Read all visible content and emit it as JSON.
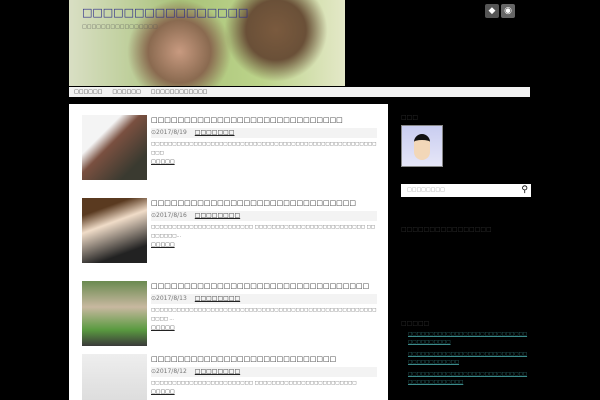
{
  "site": {
    "title": "□□□□□□□□□□□□□□□□",
    "description": "□□□□□□□□□□□□□□□□"
  },
  "header_icons": [
    "feedly-icon",
    "rss-icon"
  ],
  "nav": [
    "□□□□□□",
    "□□□□□□",
    "□□□□□□□□□□□□"
  ],
  "posts": [
    {
      "title": "□□□□□□□□□□□□□□□□□□□□□□□□□□□□□",
      "date": "2017/8/19",
      "category": "□□□□□□□",
      "excerpt": "□□□□□□□□□□□□□□□□□□□□□□□□□□□□□□□□□□□□□□□□□□□□□□□□□□□□□□□□",
      "more": "□□□□□"
    },
    {
      "title": "□□□□□□□□□□□□□□□□□□□□□□□□□□□□□□□",
      "date": "2017/8/16",
      "category": "□□□□□□□□",
      "excerpt": "□□□□□□□□□□□□□□□□□□□□□□□□ □□□□□□□□□□□□□□□□□□□□□□□□□□ □□□□□□□□…",
      "more": "□□□□□"
    },
    {
      "title": "□□□□□□□□□□□□□□□□□□□□□□□□□□□□□□□□□",
      "date": "2017/8/13",
      "category": "□□□□□□□□",
      "excerpt": "□□□□□□□□□□□□□□□□□□□□□□□□□□□□□□□□□□□□□□□□□□□□□□□□□□□□□□□□□ …",
      "more": "□□□□□"
    },
    {
      "title": "□□□□□□□□□□□□□□□□□□□□□□□□□□□□",
      "date": "2017/8/12",
      "category": "□□□□□□□□",
      "excerpt": "□□□□□□□□□□□□□□□□□□□□□□□□ □□□□□□□□□□□□□□□□□□□□□□□□",
      "more": "□□□□□"
    }
  ],
  "sidebar": {
    "profile_title": "□□□",
    "search_placeholder": "□□□□□□□□",
    "widget2_title": "□□□□□□□□□□□□□□□□",
    "recent_title": "□□□□□",
    "recent": [
      "□□□□□□□□□□□□□□□□□□□□□□□□□□□□□□□□□□□□□□",
      "□□□□□□□□□□□□□□□□□□□□□□□□□□□□□□□□□□□□□□□□",
      "□□□□□□□□□□□□□□□□□□□□□□□□□□□□□□□□□□□□□□□□□"
    ]
  }
}
